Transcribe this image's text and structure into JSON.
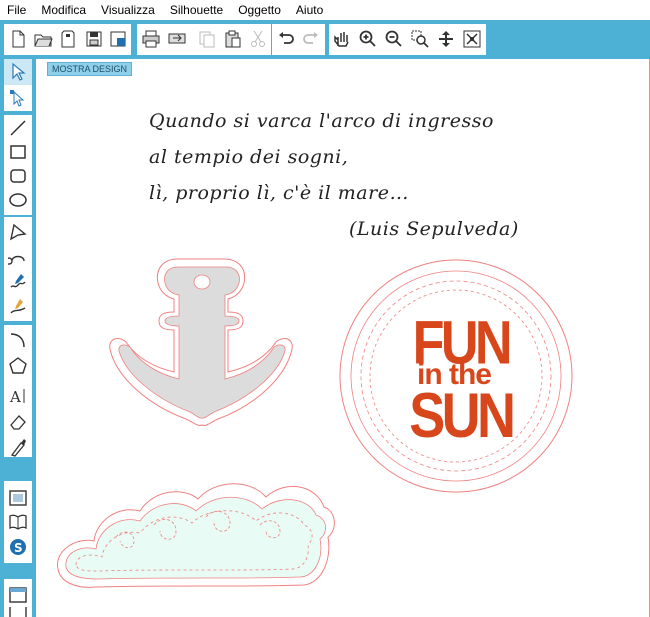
{
  "menu": {
    "items": [
      "File",
      "Modifica",
      "Visualizza",
      "Silhouette",
      "Oggetto",
      "Aiuto"
    ]
  },
  "toolbar": {
    "buttons": [
      "new-icon",
      "open-icon",
      "sd-card-icon",
      "save-icon",
      "library-save-icon",
      "print-icon",
      "send-to-cutter-icon",
      "copy-icon",
      "paste-icon",
      "cut-icon",
      "undo-icon",
      "redo-icon",
      "pan-icon",
      "zoom-in-icon",
      "zoom-out-icon",
      "zoom-select-icon",
      "fit-to-page-icon",
      "zoom-fit-icon"
    ]
  },
  "canvas": {
    "show_design_label": "MOSTRA DESIGN",
    "quote": {
      "lines": [
        "Quando si varca l'arco di ingresso",
        "al tempio dei sogni,",
        "lì, proprio lì, c'è il mare…"
      ],
      "author": "(Luis Sepulveda)"
    },
    "badge_text": {
      "line1": "FUN",
      "line2": "in the",
      "line3": "SUN"
    }
  },
  "colors": {
    "toolbar_bg": "#4db0d5",
    "cut_line": "#f08080",
    "anchor_fill": "#dcdcdc",
    "wave_fill": "#e8fbf5",
    "sun_text": "#d8461c"
  }
}
